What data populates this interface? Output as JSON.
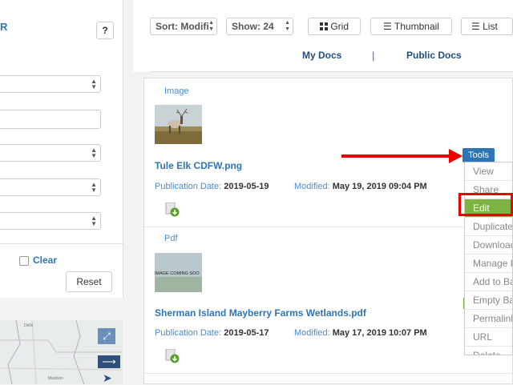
{
  "sidebar": {
    "title": "R",
    "help_label": "?",
    "clear_label": "Clear",
    "reset_label": "Reset"
  },
  "toolbar": {
    "sort_label": "Sort: Modifi",
    "show_label": "Show: 24",
    "grid_label": "Grid",
    "thumbnail_label": "Thumbnail",
    "list_label": "List"
  },
  "tabs": {
    "my_docs": "My Docs",
    "separator": "|",
    "public_docs": "Public Docs"
  },
  "results": [
    {
      "type": "Image",
      "name": "Tule Elk CDFW.png",
      "pub_label": "Publication Date:",
      "pub_date": "2019-05-19",
      "mod_label": "Modified:",
      "mod_date": "May 19, 2019 09:04 PM"
    },
    {
      "type": "Pdf",
      "thumb_text": "IMAGE COMING SOO",
      "name": "Sherman Island Mayberry Farms Wetlands.pdf",
      "pub_label": "Publication Date:",
      "pub_date": "2019-05-17",
      "mod_label": "Modified:",
      "mod_date": "May 17, 2019 10:07 PM"
    }
  ],
  "tools": {
    "button_label": "Tools",
    "items": [
      "View",
      "Share",
      "Edit",
      "Duplicate",
      "Download",
      "Manage R",
      "Add to Ba",
      "Empty Ba",
      "Permalink",
      "URL",
      "Delete"
    ]
  },
  "map": {
    "place_labels": [
      "Delhi",
      "Madison"
    ]
  },
  "colors": {
    "accent": "#2f74b5",
    "edit_highlight": "#7cb342",
    "annotation": "#e00000"
  }
}
